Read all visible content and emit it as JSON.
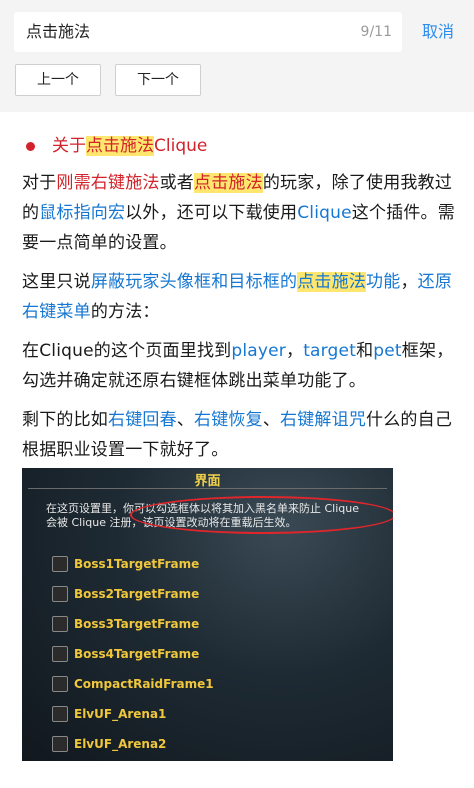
{
  "search": {
    "query": "点击施法",
    "count": "9/11",
    "cancel_label": "取消"
  },
  "nav": {
    "prev_label": "上一个",
    "next_label": "下一个"
  },
  "article": {
    "heading": {
      "pre": "关于",
      "hl": "点击施法",
      "post": "Clique"
    },
    "p1": {
      "a": "对于",
      "b": "刚需右键施法",
      "c": "或者",
      "d": "点击施法",
      "e": "的玩家，除了使用我教过的",
      "f": "鼠标指向宏",
      "g": "以外，还可以下载使用",
      "h": "Clique",
      "i": "这个插件。需要一点简单的设置。"
    },
    "p2": {
      "a": "这里只说",
      "b": "屏蔽玩家头像框和目标框的",
      "c": "点击施法",
      "d": "功能",
      "e": "，",
      "f": "还原右键菜单",
      "g": "的方法："
    },
    "p3": {
      "a": "在Clique的这个页面里找到",
      "b": "player",
      "c": "，",
      "d": "target",
      "e": "和",
      "f": "pet",
      "g": "框架，勾选并确定就还原右键框体跳出菜单功能了。"
    },
    "p4": {
      "a": "剩下的比如",
      "b": "右键回春",
      "c": "、",
      "d": "右键恢复",
      "e": "、",
      "f": "右键解诅咒",
      "g": "什么的自己根据职业设置一下就好了。"
    }
  },
  "screenshot": {
    "title": "界面",
    "line1": "在这页设置里，你可以勾选框体以将其加入黑名单来防止 Clique",
    "line2": "会被 Clique 注册，该页设置改动将在重载后生效。",
    "frames": [
      "Boss1TargetFrame",
      "Boss2TargetFrame",
      "Boss3TargetFrame",
      "Boss4TargetFrame",
      "CompactRaidFrame1",
      "ElvUF_Arena1",
      "ElvUF_Arena2"
    ]
  },
  "colors": {
    "accent_blue": "#1677d2",
    "accent_red": "#d2232a",
    "highlight_yellow": "#ffe66e"
  }
}
